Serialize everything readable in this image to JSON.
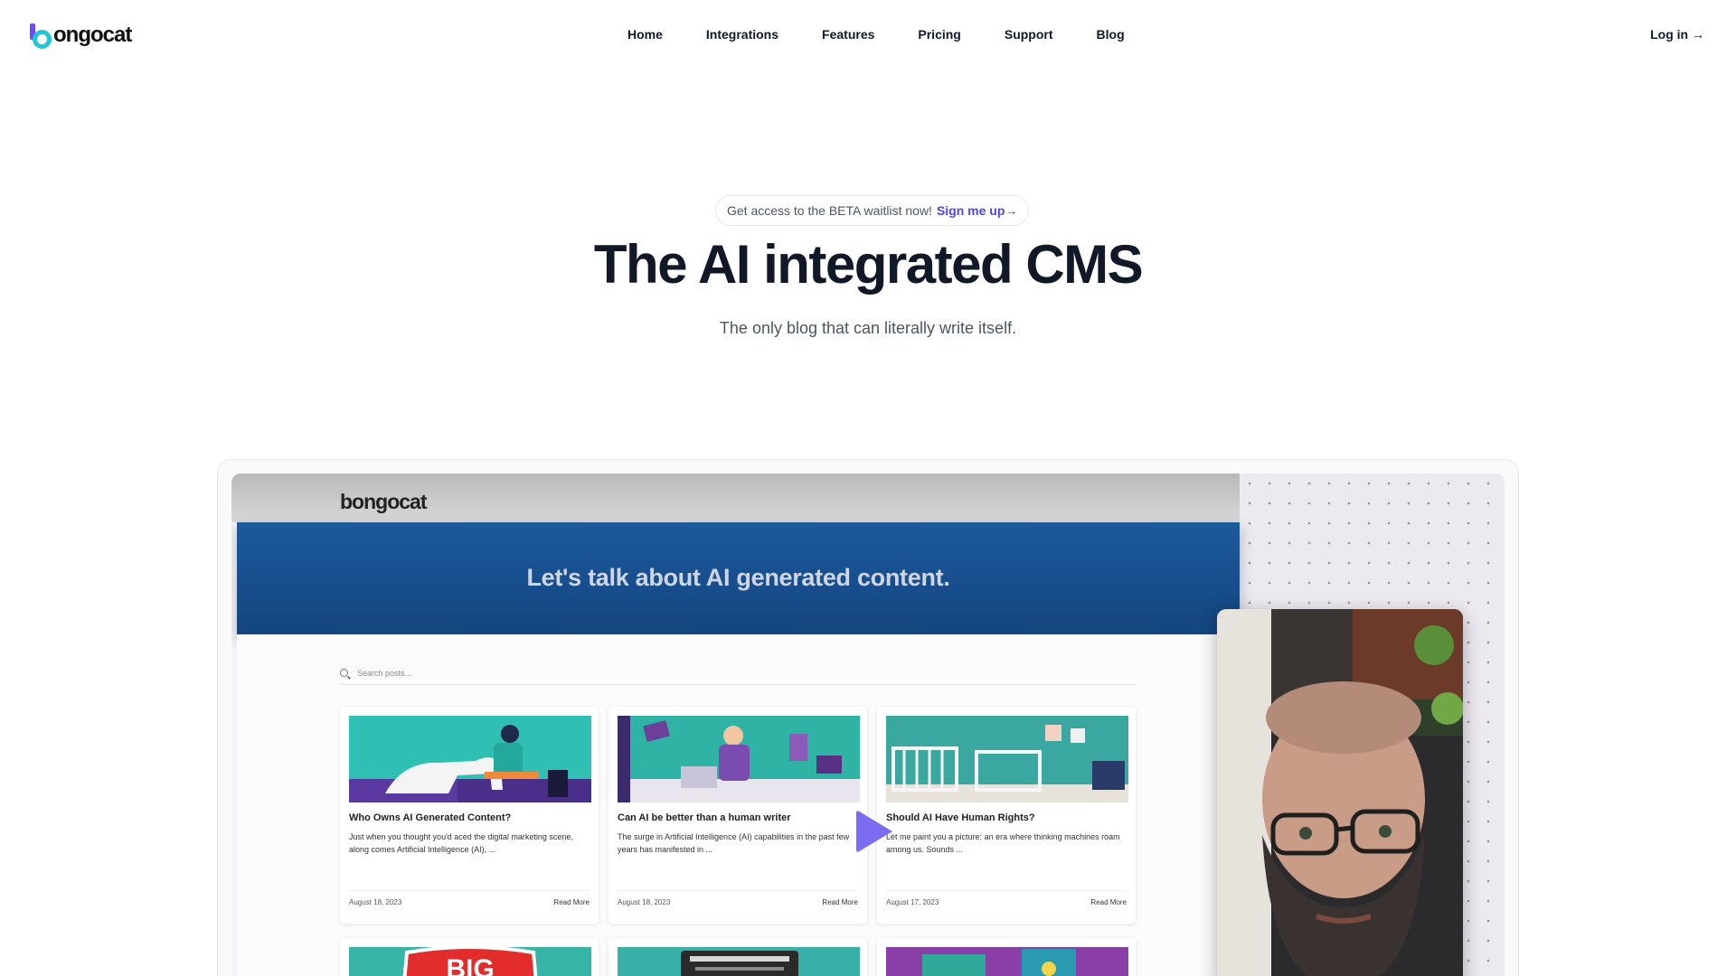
{
  "brand": {
    "name": "ongocat",
    "colors": {
      "mark_bar": "#6d4aff",
      "mark_ring": "#22c7d6"
    }
  },
  "nav": {
    "links": [
      "Home",
      "Integrations",
      "Features",
      "Pricing",
      "Support",
      "Blog"
    ],
    "login": "Log in →"
  },
  "hero": {
    "announcement": "Get access to the BETA waitlist now!",
    "announcement_cta": "Sign me up→",
    "title": "The AI integrated CMS",
    "subtitle": "The only blog that can literally write itself."
  },
  "demo": {
    "logo_text": "bongocat",
    "banner": "Let's talk about AI generated content.",
    "search_placeholder": "Search posts...",
    "posts": [
      {
        "title": "Who Owns AI Generated Content?",
        "excerpt": "Just when you thought you'd aced the digital marketing scene, along comes Artificial Intelligence (AI), ...",
        "date": "August 18, 2023",
        "read_more": "Read More"
      },
      {
        "title": "Can AI be better than a human writer",
        "excerpt": "The surge in Artificial Intelligence (AI) capabilities in the past few years has manifested in ...",
        "date": "August 18, 2023",
        "read_more": "Read More"
      },
      {
        "title": "Should AI Have Human Rights?",
        "excerpt": "Let me paint you a picture: an era where thinking machines roam among us. Sounds ...",
        "date": "August 17, 2023",
        "read_more": "Read More"
      }
    ],
    "second_row_first_image_text": "BIG",
    "accent_colors": {
      "play": "#7c6cf2",
      "banner": "#174d8c"
    }
  }
}
